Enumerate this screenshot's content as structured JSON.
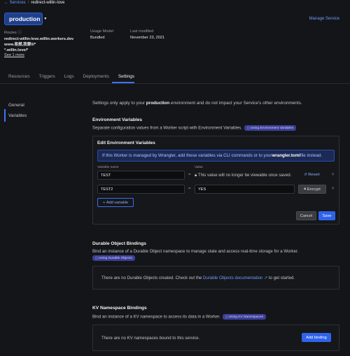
{
  "breadcrumb": {
    "parent": "Services",
    "current": "redirect-willin-love"
  },
  "environment": {
    "name": "production"
  },
  "manage_service": "Manage Service",
  "meta": {
    "routes_label": "Routes",
    "routes": [
      "redirect-willin-love.willin.workers.dev",
      "www.易燃,我要0/*",
      "*.willin.love/*"
    ],
    "see_more": "See 1 more",
    "usage_label": "Usage Model",
    "usage_value": "Bundled",
    "modified_label": "Last modified",
    "modified_value": "November 23, 2021"
  },
  "tabs": [
    "Resources",
    "Triggers",
    "Logs",
    "Deployments",
    "Settings"
  ],
  "active_tab": "Settings",
  "sidebar": {
    "items": [
      "General",
      "Variables"
    ],
    "active": "Variables"
  },
  "intro": {
    "pre": "Settings only apply to your ",
    "env": "production",
    "post": " environment and do not impact your Service's other environments."
  },
  "env_vars": {
    "heading": "Environment Variables",
    "description": "Separate configuration values from a Worker script with Environment Variables.",
    "badge": "Using Environment Variables",
    "edit_title": "Edit Environment Variables",
    "info_pre": "If this Worker is managed by Wrangler, add these variables via CLI commands or to your ",
    "info_file": "wrangler.toml",
    "info_post": " file instead.",
    "col_name": "Variable name",
    "col_value": "Value",
    "rows": [
      {
        "name": "TEST",
        "hidden_note": "This value will no longer be viewable once saved.",
        "action": "Revert"
      },
      {
        "name": "TEST2",
        "value": "YES",
        "action": "Encrypt"
      }
    ],
    "add_variable": "Add variable",
    "cancel": "Cancel",
    "save": "Save"
  },
  "durable_objects": {
    "heading": "Durable Object Bindings",
    "description": "Bind an instance of a Durable Object namespace to manage state and access real-time storage for a Worker.",
    "badge": "Using Durable Objects",
    "empty_pre": "There are no Durable Objects created. Check out the ",
    "empty_link": "Durable Objects documentation",
    "empty_post": " to get started."
  },
  "kv": {
    "heading": "KV Namespace Bindings",
    "description": "Bind an instance of a KV namespace to access its data in a Worker.",
    "badge": "Using KV Namespaces",
    "empty": "There are no KV namespaces bound to this service.",
    "add_binding": "Add binding"
  }
}
